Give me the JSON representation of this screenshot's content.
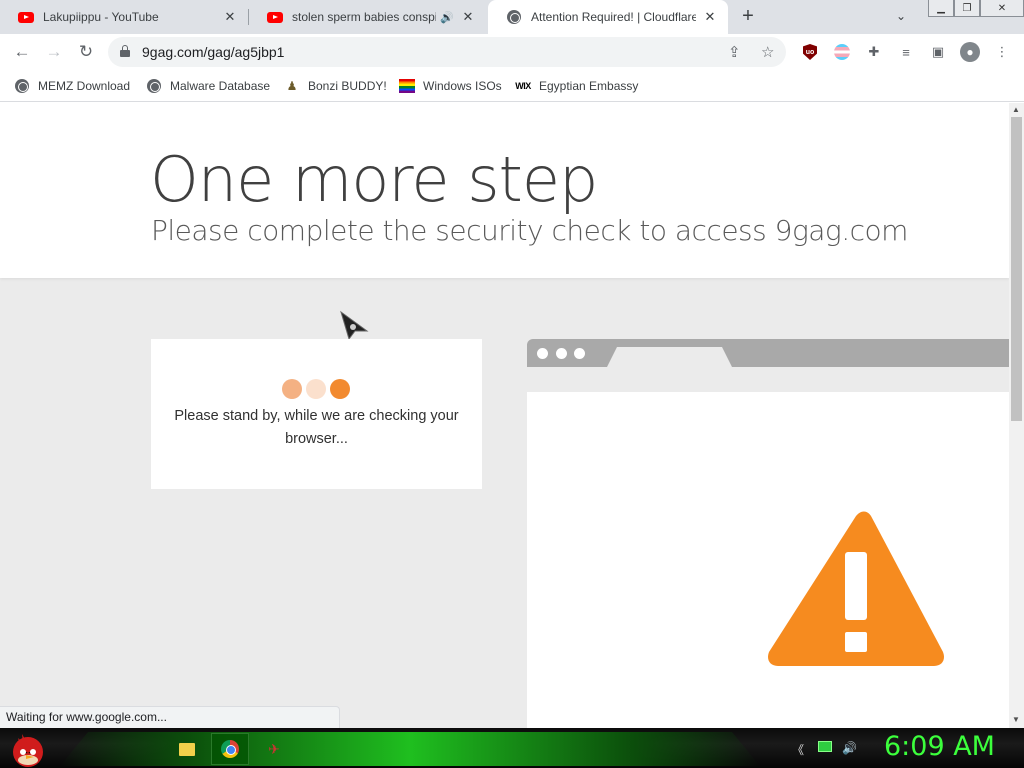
{
  "browser": {
    "tabs": [
      {
        "title": "Lakupiippu - YouTube",
        "favicon": "youtube-icon",
        "active": false
      },
      {
        "title": "stolen sperm babies conspir",
        "favicon": "youtube-icon",
        "audio": true,
        "active": false
      },
      {
        "title": "Attention Required! | Cloudflare",
        "favicon": "globe-icon",
        "active": true
      }
    ],
    "new_tab_label": "+",
    "url": "9gag.com/gag/ag5jbp1",
    "bookmarks": [
      {
        "label": "MEMZ Download",
        "icon": "globe-icon"
      },
      {
        "label": "Malware Database",
        "icon": "globe-icon"
      },
      {
        "label": "Bonzi BUDDY!",
        "icon": "bonzi-icon"
      },
      {
        "label": "Windows ISOs",
        "icon": "rainbow-flag-icon"
      },
      {
        "label": "Egyptian Embassy",
        "icon": "wix-icon"
      }
    ],
    "status_bubble": "Waiting for www.google.com..."
  },
  "page": {
    "heading": "One more step",
    "subheading": "Please complete the security check to access 9gag.com",
    "check_message": "Please stand by, while we are checking your browser...",
    "loader_dot_colors": [
      "#f4b183",
      "#fbe0cd",
      "#f28a2f"
    ],
    "warning_color": "#f68b1f"
  },
  "taskbar": {
    "clock": "6:09 AM",
    "items": [
      "folder-icon",
      "chrome-icon",
      "angry-bird-icon"
    ]
  }
}
